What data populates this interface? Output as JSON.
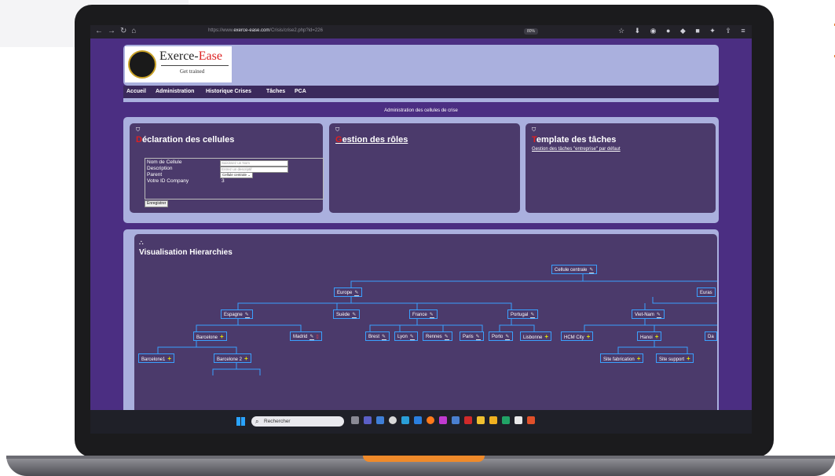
{
  "browser": {
    "url_prefix": "https://www.",
    "url_host": "exerce-ease.com",
    "url_path": "/Crisis/crise2.php?id=226",
    "zoom": "80%"
  },
  "logo": {
    "title_part1": "Exerce-",
    "title_part2": "Ease",
    "subtitle": "Get trained"
  },
  "menu": {
    "items": [
      "Accueil",
      "Administration",
      "Historique Crises",
      "Tâches",
      "PCA"
    ]
  },
  "admin_title": "Administration des cellules de crise",
  "cards": {
    "declaration": {
      "title_cap": "D",
      "title_rest": "éclaration des cellules",
      "labels": [
        "Nom de Cellule",
        "Description",
        "Parent",
        "Votre ID Company"
      ],
      "name_placeholder": "Saisissez un Nom",
      "desc_placeholder": "Entrez un descriptif",
      "parent_value": "Cellule centrale",
      "company_id": "3",
      "save_label": "Enregistrer"
    },
    "roles": {
      "title_cap": "G",
      "title_rest": "estion des rôles"
    },
    "tasks": {
      "title_cap": "T",
      "title_rest": "emplate des tâches",
      "link": "Gestion des tâches \"entreprise\" par défaut"
    }
  },
  "hierarchy": {
    "title": "Visualisation Hierarchies",
    "nodes": {
      "root": "Cellule centrale",
      "europe": "Europe",
      "euras": "Euras",
      "espagne": "Espagne",
      "suede": "Suède",
      "france": "France",
      "portugal": "Portugal",
      "vietnam": "Viet-Nam",
      "barcelone": "Barcelone",
      "madrid": "Madrid",
      "brest": "Brest",
      "lyon": "Lyon",
      "rennes": "Rennes",
      "paris": "Paris",
      "porto": "Porto",
      "lisbonne": "Lisbonne",
      "hcm": "HCM City",
      "hanoi": "Hanoi",
      "da": "Da",
      "barcelone1": "Barcelone1",
      "barcelone2": "Barcelone 2",
      "site_fab": "Site fabrication",
      "site_support": "Site support"
    }
  },
  "taskbar": {
    "search_placeholder": "Rechercher"
  },
  "colors": {
    "page_bg": "#4b2e82",
    "band": "#aab0de",
    "card": "#4b3a6b",
    "node_border": "#3aa0ff",
    "accent_red": "#e02020",
    "orange": "#ef8a2a"
  }
}
